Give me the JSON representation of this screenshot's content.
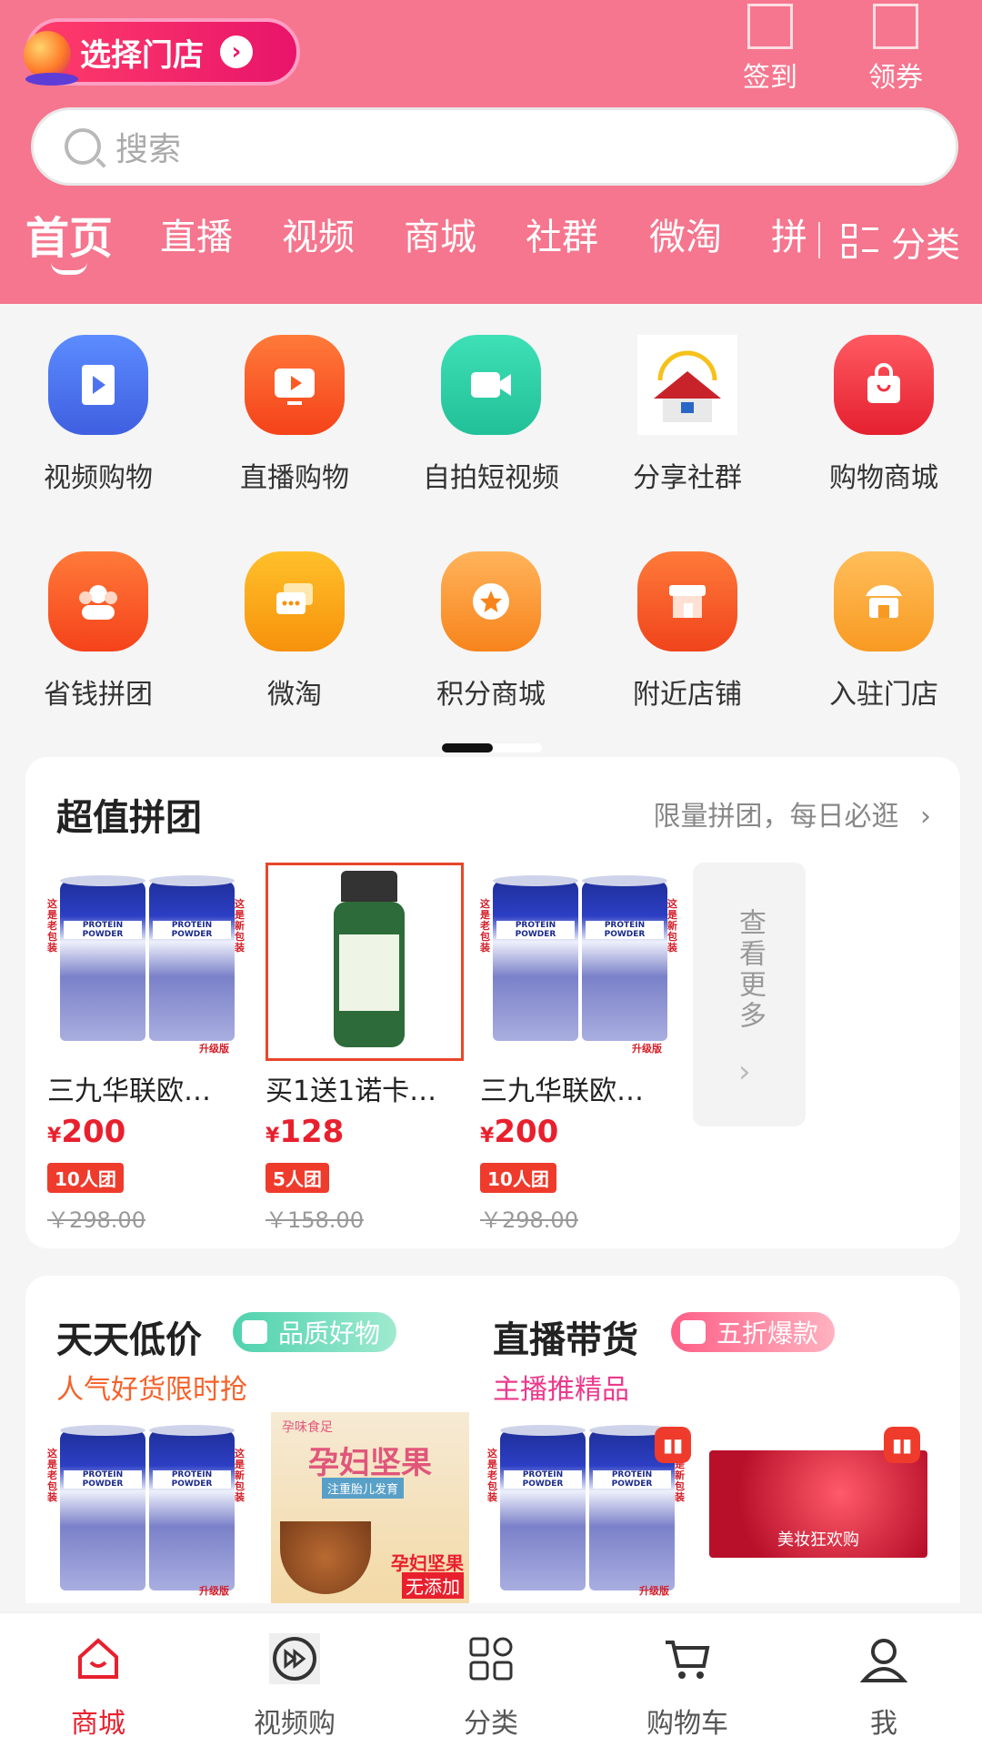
{
  "header": {
    "store_button": "选择门店",
    "actions": [
      {
        "label": "签到"
      },
      {
        "label": "领券"
      }
    ],
    "search_placeholder": "搜索",
    "tabs": [
      "首页",
      "直播",
      "视频",
      "商城",
      "社群",
      "微淘",
      "拼"
    ],
    "category_tab": "分类"
  },
  "grid": [
    {
      "label": "视频购物",
      "icon": "video-shopping-icon",
      "color": "#4f73f0"
    },
    {
      "label": "直播购物",
      "icon": "live-shopping-icon",
      "color": "#fb5a25"
    },
    {
      "label": "自拍短视频",
      "icon": "camera-icon",
      "color": "#2fd0a5"
    },
    {
      "label": "分享社群",
      "icon": "house-sun-icon",
      "color": "#ffffff"
    },
    {
      "label": "购物商城",
      "icon": "shopping-bag-icon",
      "color": "#f1303f"
    },
    {
      "label": "省钱拼团",
      "icon": "group-icon",
      "color": "#fb5a25"
    },
    {
      "label": "微淘",
      "icon": "chat-icon",
      "color": "#fca71a"
    },
    {
      "label": "积分商城",
      "icon": "star-icon",
      "color": "#fc9b3a"
    },
    {
      "label": "附近店铺",
      "icon": "store-icon",
      "color": "#f65c2c"
    },
    {
      "label": "入驻门店",
      "icon": "shop-join-icon",
      "color": "#fcac3c"
    }
  ],
  "group_deal": {
    "title": "超值拼团",
    "subtitle": "限量拼团，每日必逛",
    "more": "查看更多",
    "products": [
      {
        "name": "三九华联欧…",
        "price": "200",
        "currency": "¥",
        "tag": "10人团",
        "original": "￥298.00"
      },
      {
        "name": "买1送1诺卡…",
        "price": "128",
        "currency": "¥",
        "tag": "5人团",
        "original": "￥158.00"
      },
      {
        "name": "三九华联欧…",
        "price": "200",
        "currency": "¥",
        "tag": "10人团",
        "original": "￥298.00"
      }
    ],
    "can_text": "PROTEIN POWDER",
    "can_side_left": "这是老包装",
    "can_side_right": "这是新包装",
    "can_upgrade": "升级版"
  },
  "sections": {
    "low_price": {
      "title": "天天低价",
      "badge": "品质好物",
      "subtitle": "人气好货限时抢",
      "badge_color": "#5fd6b2"
    },
    "live": {
      "title": "直播带货",
      "badge": "五折爆款",
      "subtitle": "主播推精品",
      "badge_color": "#ff6f8e"
    },
    "nut_image": {
      "brand": "孕味食足",
      "title": "孕妇坚果",
      "sub": "注重胎儿发育",
      "t4": "孕妇坚果",
      "t5": "无添加"
    },
    "beauty_image": {
      "text": "美妆狂欢购"
    }
  },
  "bottom_nav": [
    {
      "label": "商城",
      "icon": "home-icon"
    },
    {
      "label": "视频购",
      "icon": "video-play-icon"
    },
    {
      "label": "分类",
      "icon": "category-icon"
    },
    {
      "label": "购物车",
      "icon": "cart-icon"
    },
    {
      "label": "我",
      "icon": "user-icon"
    }
  ],
  "colors": {
    "brand_pink": "#f5768e",
    "price_red": "#e8202e"
  }
}
